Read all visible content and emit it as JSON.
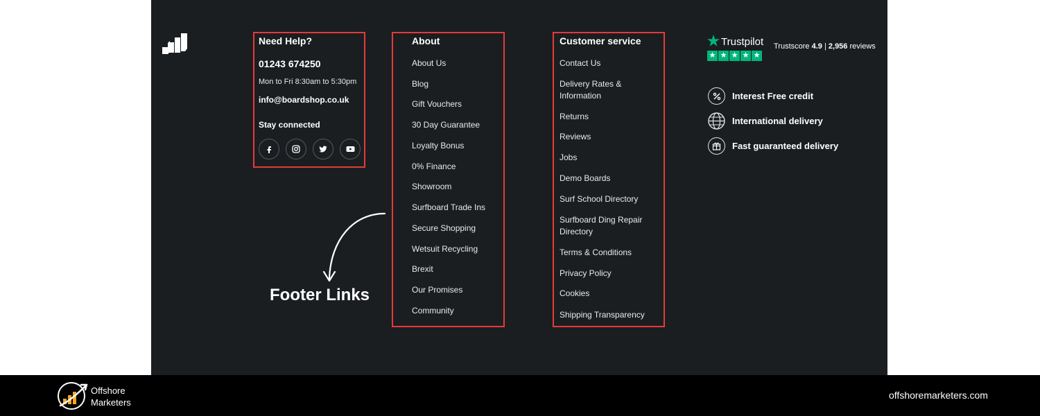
{
  "help": {
    "heading": "Need Help?",
    "phone": "01243 674250",
    "hours": "Mon to Fri 8:30am to 5:30pm",
    "email": "info@boardshop.co.uk",
    "stay_connected": "Stay connected",
    "social": [
      "facebook-icon",
      "instagram-icon",
      "twitter-icon",
      "youtube-icon"
    ]
  },
  "about": {
    "heading": "About",
    "links": [
      "About Us",
      "Blog",
      "Gift Vouchers",
      "30 Day Guarantee",
      "Loyalty Bonus",
      "0% Finance",
      "Showroom",
      "Surfboard Trade Ins",
      "Secure Shopping",
      "Wetsuit Recycling",
      "Brexit",
      "Our Promises",
      "Community"
    ]
  },
  "customer_service": {
    "heading": "Customer service",
    "links": [
      "Contact Us",
      "Delivery Rates & Information",
      "Returns",
      "Reviews",
      "Jobs",
      "Demo Boards",
      "Surf School Directory",
      "Surfboard Ding Repair Directory",
      "Terms & Conditions",
      "Privacy Policy",
      "Cookies",
      "Shipping Transparency"
    ]
  },
  "trustpilot": {
    "name": "Trustpilot",
    "trustscore_label": "Trustscore",
    "score": "4.9",
    "separator": "|",
    "review_count": "2,956",
    "reviews_label": "reviews",
    "rating_stars": 5,
    "brand_color": "#00b67a"
  },
  "features": [
    {
      "icon": "percent-icon",
      "label": "Interest Free credit"
    },
    {
      "icon": "globe-icon",
      "label": "International delivery"
    },
    {
      "icon": "gift-box-icon",
      "label": "Fast guaranteed delivery"
    }
  ],
  "annotation": {
    "label": "Footer Links",
    "highlight_color": "#e63a3a"
  },
  "branding": {
    "line1": "Offshore",
    "line2": "Marketers",
    "website": "offshoremarketers.com"
  },
  "colors": {
    "panel": "#1b1e21",
    "bottom_bar": "#000000"
  }
}
